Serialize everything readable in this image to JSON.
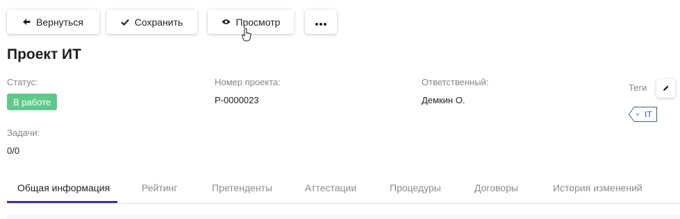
{
  "toolbar": {
    "back_label": "Вернуться",
    "save_label": "Сохранить",
    "view_label": "Просмотр",
    "more_icon": "more-horizontal-icon"
  },
  "project": {
    "title": "Проект ИТ",
    "status_label": "Статус:",
    "status_value": "В работе",
    "number_label": "Номер проекта:",
    "number_value": "P-0000023",
    "owner_label": "Ответственный:",
    "owner_value": "Демкин О.",
    "tags_label": "Теги",
    "tags": [
      "IT"
    ],
    "tasks_label": "Задачи:",
    "tasks_value": "0/0"
  },
  "tabs": [
    {
      "label": "Общая информация",
      "active": true
    },
    {
      "label": "Рейтинг",
      "active": false
    },
    {
      "label": "Претенденты",
      "active": false
    },
    {
      "label": "Аттестации",
      "active": false
    },
    {
      "label": "Процедуры",
      "active": false
    },
    {
      "label": "Договоры",
      "active": false
    },
    {
      "label": "История изменений",
      "active": false
    }
  ],
  "colors": {
    "status_badge": "#5fc98a",
    "tab_indicator": "#3d3192",
    "tag_border": "#3b5b89"
  }
}
